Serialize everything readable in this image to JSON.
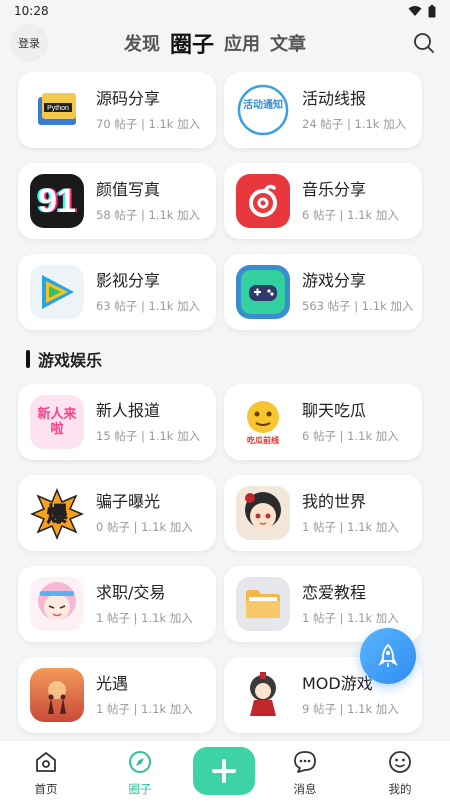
{
  "status_bar": {
    "time": "10:28"
  },
  "top_nav": {
    "login_label": "登录",
    "tabs": [
      {
        "label": "发现"
      },
      {
        "label": "圈子"
      },
      {
        "label": "应用"
      },
      {
        "label": "文章"
      }
    ],
    "active_tab": "圈子"
  },
  "circles_top": [
    {
      "name": "源码分享",
      "stats": "70 帖子 | 1.1k 加入",
      "icon": "python-book-icon"
    },
    {
      "name": "活动线报",
      "stats": "24 帖子 | 1.1k 加入",
      "icon": "activity-notice-icon",
      "icon_text": "活动通知"
    },
    {
      "name": "颜值写真",
      "stats": "58 帖子 | 1.1k 加入",
      "icon": "number-91-icon",
      "icon_text": "91"
    },
    {
      "name": "音乐分享",
      "stats": "6 帖子 | 1.1k 加入",
      "icon": "netease-music-icon"
    },
    {
      "name": "影视分享",
      "stats": "63 帖子 | 1.1k 加入",
      "icon": "video-play-icon"
    },
    {
      "name": "游戏分享",
      "stats": "563 帖子 | 1.1k 加入",
      "icon": "gamepad-icon"
    }
  ],
  "section": {
    "title": "游戏娱乐"
  },
  "circles_game": [
    {
      "name": "新人报道",
      "stats": "15 帖子 | 1.1k 加入",
      "icon": "newcomer-badge-icon",
      "icon_text": "新人来啦"
    },
    {
      "name": "聊天吃瓜",
      "stats": "6 帖子 | 1.1k 加入",
      "icon": "emoji-face-icon",
      "icon_text": "吃瓜前线"
    },
    {
      "name": "骗子曝光",
      "stats": "0 帖子 | 1.1k 加入",
      "icon": "explode-badge-icon",
      "icon_text": "爆"
    },
    {
      "name": "我的世界",
      "stats": "1 帖子 | 1.1k 加入",
      "icon": "anime-girl-avatar-icon"
    },
    {
      "name": "求职/交易",
      "stats": "1 帖子 | 1.1k 加入",
      "icon": "anime-pink-girl-icon"
    },
    {
      "name": "恋爱教程",
      "stats": "1 帖子 | 1.1k 加入",
      "icon": "folder-icon"
    },
    {
      "name": "光遇",
      "stats": "1 帖子 | 1.1k 加入",
      "icon": "sky-sunset-icon"
    },
    {
      "name": "MOD游戏",
      "stats": "9 帖子 | 1.1k 加入",
      "icon": "anime-red-girl-icon"
    }
  ],
  "fab": {
    "icon": "rocket-icon"
  },
  "bottom_nav": {
    "items": [
      {
        "label": "首页",
        "icon": "home-icon"
      },
      {
        "label": "圈子",
        "icon": "compass-icon"
      },
      {
        "label": "消息",
        "icon": "chat-bubble-icon"
      },
      {
        "label": "我的",
        "icon": "smile-face-icon"
      }
    ],
    "add_icon": "plus-icon"
  },
  "colors": {
    "accent": "#3ed3a6",
    "active_label": "#2fbf9a",
    "fab": "#2e8cf0",
    "background": "#f4f5f7"
  }
}
